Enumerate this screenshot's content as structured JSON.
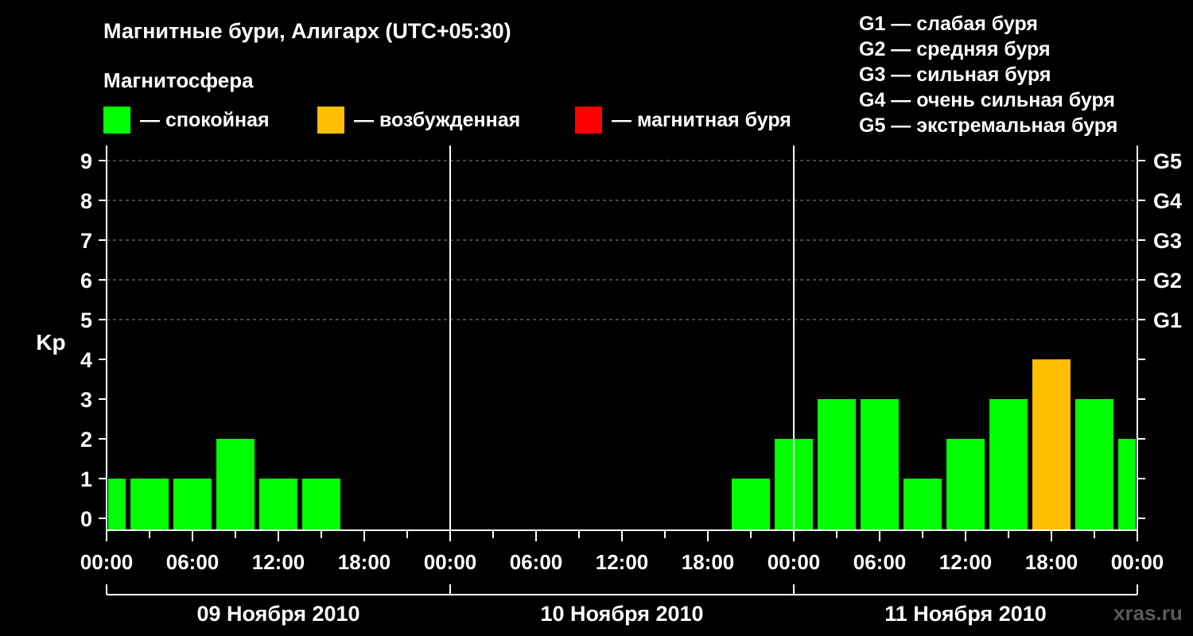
{
  "title": "Магнитные бури, Алигарх (UTC+05:30)",
  "subtitle": "Магнитосфера",
  "legend": [
    {
      "label": "— спокойная",
      "color": "#00ff00"
    },
    {
      "label": "— возбужденная",
      "color": "#ffbf00"
    },
    {
      "label": "— магнитная буря",
      "color": "#ff0000"
    }
  ],
  "g_legend": [
    "G1 — слабая буря",
    "G2 — средняя буря",
    "G3 — сильная буря",
    "G4 — очень сильная буря",
    "G5 — экстремальная буря"
  ],
  "watermark": "xras.ru",
  "chart_data": {
    "type": "bar",
    "ylabel": "Kp",
    "ylim": [
      0,
      9
    ],
    "y_ticks": [
      0,
      1,
      2,
      3,
      4,
      5,
      6,
      7,
      8,
      9
    ],
    "right_labels": [
      {
        "y": 5,
        "label": "G1"
      },
      {
        "y": 6,
        "label": "G2"
      },
      {
        "y": 7,
        "label": "G3"
      },
      {
        "y": 8,
        "label": "G4"
      },
      {
        "y": 9,
        "label": "G5"
      }
    ],
    "x_range_hours": [
      0,
      72
    ],
    "x_ticks": [
      {
        "hour": 0,
        "label": "00:00"
      },
      {
        "hour": 6,
        "label": "06:00"
      },
      {
        "hour": 12,
        "label": "12:00"
      },
      {
        "hour": 18,
        "label": "18:00"
      },
      {
        "hour": 24,
        "label": "00:00"
      },
      {
        "hour": 30,
        "label": "06:00"
      },
      {
        "hour": 36,
        "label": "12:00"
      },
      {
        "hour": 42,
        "label": "18:00"
      },
      {
        "hour": 48,
        "label": "00:00"
      },
      {
        "hour": 54,
        "label": "06:00"
      },
      {
        "hour": 60,
        "label": "12:00"
      },
      {
        "hour": 66,
        "label": "18:00"
      },
      {
        "hour": 72,
        "label": "00:00"
      }
    ],
    "days": [
      {
        "label": "09 Ноября 2010",
        "start": 0,
        "end": 24
      },
      {
        "label": "10 Ноября 2010",
        "start": 24,
        "end": 48
      },
      {
        "label": "11 Ноября 2010",
        "start": 48,
        "end": 72
      }
    ],
    "grid_levels": [
      5,
      6,
      7,
      8,
      9
    ],
    "colors": {
      "quiet": "#00ff00",
      "active": "#ffbf00",
      "storm": "#ff0000"
    },
    "bars": [
      {
        "start": 0,
        "end": 1.5,
        "kp": 1,
        "state": "quiet"
      },
      {
        "start": 1.5,
        "end": 4.5,
        "kp": 1,
        "state": "quiet"
      },
      {
        "start": 4.5,
        "end": 7.5,
        "kp": 1,
        "state": "quiet"
      },
      {
        "start": 7.5,
        "end": 10.5,
        "kp": 2,
        "state": "quiet"
      },
      {
        "start": 10.5,
        "end": 13.5,
        "kp": 1,
        "state": "quiet"
      },
      {
        "start": 13.5,
        "end": 16.5,
        "kp": 1,
        "state": "quiet"
      },
      {
        "start": 43.5,
        "end": 46.5,
        "kp": 1,
        "state": "quiet"
      },
      {
        "start": 46.5,
        "end": 49.5,
        "kp": 2,
        "state": "quiet"
      },
      {
        "start": 49.5,
        "end": 52.5,
        "kp": 3,
        "state": "quiet"
      },
      {
        "start": 52.5,
        "end": 55.5,
        "kp": 3,
        "state": "quiet"
      },
      {
        "start": 55.5,
        "end": 58.5,
        "kp": 1,
        "state": "quiet"
      },
      {
        "start": 58.5,
        "end": 61.5,
        "kp": 2,
        "state": "quiet"
      },
      {
        "start": 61.5,
        "end": 64.5,
        "kp": 3,
        "state": "quiet"
      },
      {
        "start": 64.5,
        "end": 67.5,
        "kp": 4,
        "state": "active"
      },
      {
        "start": 67.5,
        "end": 70.5,
        "kp": 3,
        "state": "quiet"
      },
      {
        "start": 70.5,
        "end": 72,
        "kp": 2,
        "state": "quiet"
      }
    ]
  }
}
